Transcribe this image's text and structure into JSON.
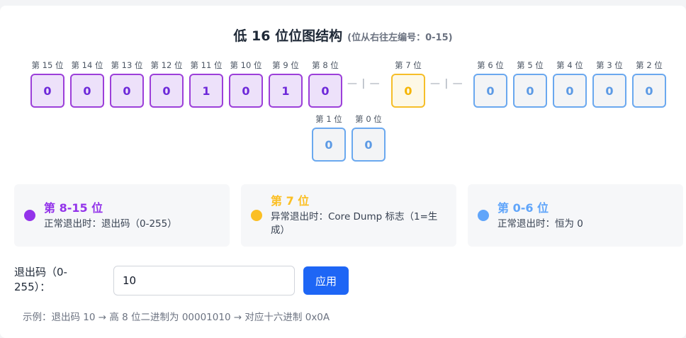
{
  "header": {
    "title": "低 16 位位图结构",
    "subtitle": "(位从右往左编号：0-15)"
  },
  "bits": {
    "b15": {
      "label": "第 15 位",
      "value": "0"
    },
    "b14": {
      "label": "第 14 位",
      "value": "0"
    },
    "b13": {
      "label": "第 13 位",
      "value": "0"
    },
    "b12": {
      "label": "第 12 位",
      "value": "0"
    },
    "b11": {
      "label": "第 11 位",
      "value": "1"
    },
    "b10": {
      "label": "第 10 位",
      "value": "0"
    },
    "b9": {
      "label": "第 9 位",
      "value": "1"
    },
    "b8": {
      "label": "第 8 位",
      "value": "0"
    },
    "b7": {
      "label": "第 7 位",
      "value": "0"
    },
    "b6": {
      "label": "第 6 位",
      "value": "0"
    },
    "b5": {
      "label": "第 5 位",
      "value": "0"
    },
    "b4": {
      "label": "第 4 位",
      "value": "0"
    },
    "b3": {
      "label": "第 3 位",
      "value": "0"
    },
    "b2": {
      "label": "第 2 位",
      "value": "0"
    },
    "b1": {
      "label": "第 1 位",
      "value": "0"
    },
    "b0": {
      "label": "第 0 位",
      "value": "0"
    }
  },
  "separator": "— | —",
  "legend": {
    "high": {
      "title": "第 8-15 位",
      "desc": "正常退出时：退出码（0-255）",
      "color": "#9333ea"
    },
    "core": {
      "title": "第 7 位",
      "desc": "异常退出时：Core Dump 标志（1=生成）",
      "color": "#fbbf24"
    },
    "low": {
      "title": "第 0-6 位",
      "desc": "正常退出时：恒为 0",
      "color": "#60a5fa"
    }
  },
  "form": {
    "label": "退出码（0-255）：",
    "value": "10",
    "apply_label": "应用"
  },
  "example": "示例：退出码 10 → 高 8 位二进制为 00001010 → 对应十六进制 0x0A"
}
